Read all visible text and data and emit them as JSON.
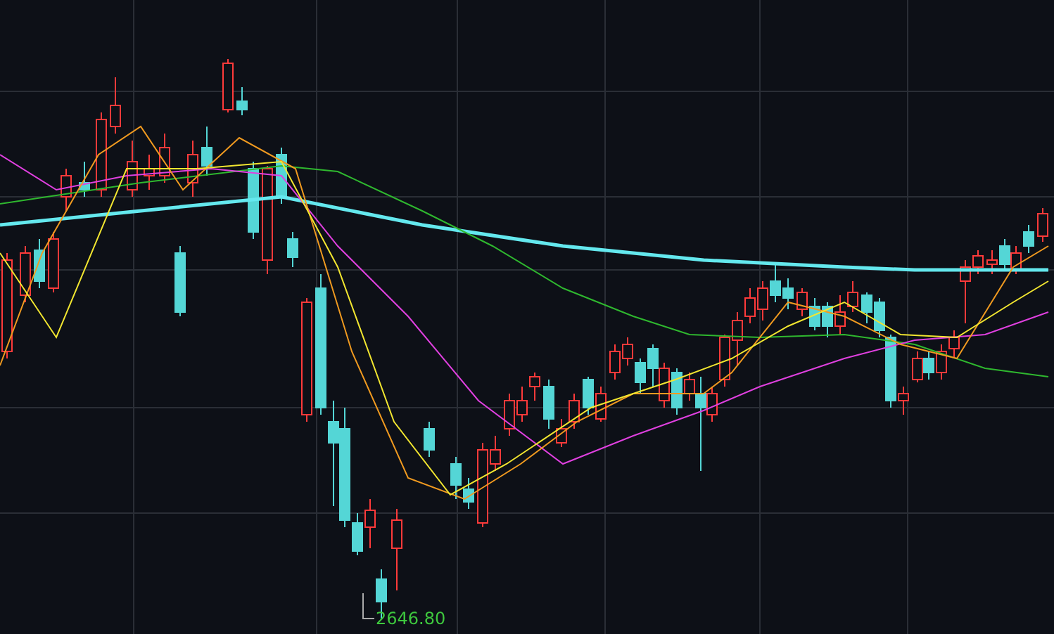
{
  "chart": {
    "low_label": "2646.80"
  }
}
